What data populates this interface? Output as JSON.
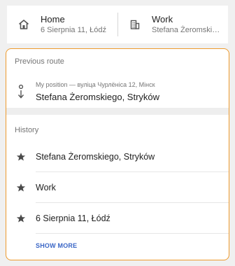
{
  "favorites": {
    "home": {
      "title": "Home",
      "address": "6 Sierpnia 11, Łódź",
      "icon": "home-icon"
    },
    "work": {
      "title": "Work",
      "address": "Stefana Żeromski…",
      "icon": "office-building-icon"
    }
  },
  "previous_route": {
    "section_title": "Previous route",
    "from": "My position — вуліца Чурлёніса 12, Мінск",
    "to": "Stefana Żeromskiego, Stryków",
    "icon": "route-arrow-icon"
  },
  "history": {
    "section_title": "History",
    "items": [
      {
        "label": "Stefana Żeromskiego, Stryków",
        "icon": "star-icon"
      },
      {
        "label": "Work",
        "icon": "star-icon"
      },
      {
        "label": "6 Sierpnia 11, Łódź",
        "icon": "star-icon"
      }
    ],
    "show_more": "SHOW MORE"
  },
  "colors": {
    "highlight_border": "#ee9a2c",
    "link": "#3a66c6"
  }
}
